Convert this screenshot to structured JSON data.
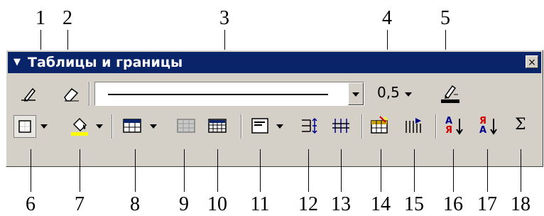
{
  "callouts": {
    "top": [
      "1",
      "2",
      "3",
      "4",
      "5"
    ],
    "bottom": [
      "6",
      "7",
      "8",
      "9",
      "10",
      "11",
      "12",
      "13",
      "14",
      "15",
      "16",
      "17",
      "18"
    ]
  },
  "toolbar": {
    "title": "Таблицы и границы",
    "close_label": "×",
    "line_style_value": "line",
    "line_weight_value": "0,5",
    "sum_symbol": "Σ",
    "sort_ascending_letters": [
      "А",
      "Я"
    ],
    "sort_descending_letters": [
      "Я",
      "А"
    ],
    "border_color": "#000000",
    "shading_color": "#ffff00"
  },
  "icons": [
    "draw-table-icon",
    "eraser-icon",
    "line-style-dropdown",
    "line-weight-dropdown",
    "border-color-icon",
    "outside-border-icon",
    "shading-color-icon",
    "insert-table-icon",
    "merge-cells-icon",
    "split-cells-icon",
    "align-icon",
    "distribute-rows-icon",
    "distribute-columns-icon",
    "table-autoformat-icon",
    "text-direction-icon",
    "sort-ascending-icon",
    "sort-descending-icon",
    "autosum-icon"
  ]
}
